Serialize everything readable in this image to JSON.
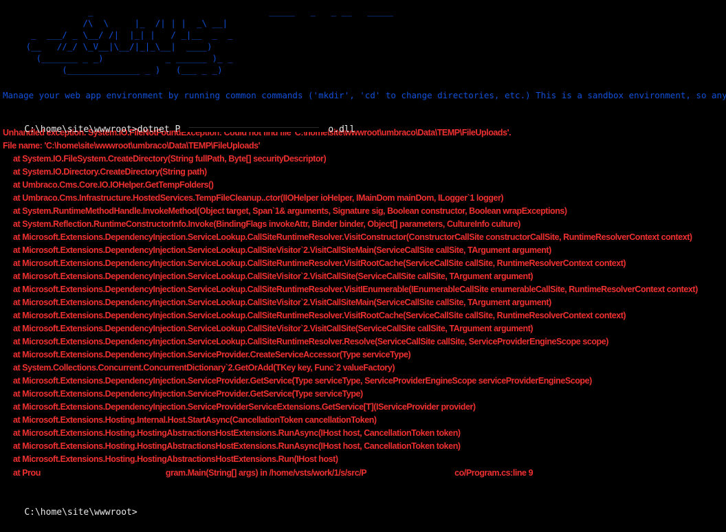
{
  "terminal": {
    "background_color": "#000000",
    "banner_color": "#1050d8",
    "prompt_color": "#e8e8e8",
    "error_color": "#f03030",
    "banner_ascii": "                 _                                  _____   _   _ __   _____\n                /\\  \\     |_  /| | |  _\\ __|\n      _  ___/ _ \\__/ /|  |_| |   / _|__  _  _\n     (__   //_/ \\_V__|\\__/|_|_\\__|  ____)\n       (_______ _ _)            _ ______ )_ _\n            (______________ _ )   (___ _ _)",
    "info_text": "Manage your web app environment by running common commands ('mkdir', 'cd' to change directories, etc.) This is a sandbox environment, so any commands that requ",
    "prompt_path": "C:\\home\\site\\wwwroot>",
    "command_prefix": "dotnet P",
    "command_suffix": "o.dll",
    "final_prompt": "C:\\home\\site\\wwwroot>"
  },
  "error_output": {
    "header_lines": [
      "Unhandled exception. System.IO.FileNotFoundException: Could not find file 'C:\\home\\site\\wwwroot\\umbraco\\Data\\TEMP\\FileUploads'.",
      "File name: 'C:\\home\\site\\wwwroot\\umbraco\\Data\\TEMP\\FileUploads'"
    ],
    "stack_frames": [
      "at System.IO.FileSystem.CreateDirectory(String fullPath, Byte[] securityDescriptor)",
      "at System.IO.Directory.CreateDirectory(String path)",
      "at Umbraco.Cms.Core.IO.IOHelper.GetTempFolders()",
      "at Umbraco.Cms.Infrastructure.HostedServices.TempFileCleanup..ctor(IIOHelper ioHelper, IMainDom mainDom, ILogger`1 logger)",
      "at System.RuntimeMethodHandle.InvokeMethod(Object target, Span`1& arguments, Signature sig, Boolean constructor, Boolean wrapExceptions)",
      "at System.Reflection.RuntimeConstructorInfo.Invoke(BindingFlags invokeAttr, Binder binder, Object[] parameters, CultureInfo culture)",
      "at Microsoft.Extensions.DependencyInjection.ServiceLookup.CallSiteRuntimeResolver.VisitConstructor(ConstructorCallSite constructorCallSite, RuntimeResolverContext context)",
      "at Microsoft.Extensions.DependencyInjection.ServiceLookup.CallSiteVisitor`2.VisitCallSiteMain(ServiceCallSite callSite, TArgument argument)",
      "at Microsoft.Extensions.DependencyInjection.ServiceLookup.CallSiteRuntimeResolver.VisitRootCache(ServiceCallSite callSite, RuntimeResolverContext context)",
      "at Microsoft.Extensions.DependencyInjection.ServiceLookup.CallSiteVisitor`2.VisitCallSite(ServiceCallSite callSite, TArgument argument)",
      "at Microsoft.Extensions.DependencyInjection.ServiceLookup.CallSiteRuntimeResolver.VisitIEnumerable(IEnumerableCallSite enumerableCallSite, RuntimeResolverContext context)",
      "at Microsoft.Extensions.DependencyInjection.ServiceLookup.CallSiteVisitor`2.VisitCallSiteMain(ServiceCallSite callSite, TArgument argument)",
      "at Microsoft.Extensions.DependencyInjection.ServiceLookup.CallSiteRuntimeResolver.VisitRootCache(ServiceCallSite callSite, RuntimeResolverContext context)",
      "at Microsoft.Extensions.DependencyInjection.ServiceLookup.CallSiteVisitor`2.VisitCallSite(ServiceCallSite callSite, TArgument argument)",
      "at Microsoft.Extensions.DependencyInjection.ServiceLookup.CallSiteRuntimeResolver.Resolve(ServiceCallSite callSite, ServiceProviderEngineScope scope)",
      "at Microsoft.Extensions.DependencyInjection.ServiceProvider.CreateServiceAccessor(Type serviceType)",
      "at System.Collections.Concurrent.ConcurrentDictionary`2.GetOrAdd(TKey key, Func`2 valueFactory)",
      "at Microsoft.Extensions.DependencyInjection.ServiceProvider.GetService(Type serviceType, ServiceProviderEngineScope serviceProviderEngineScope)",
      "at Microsoft.Extensions.DependencyInjection.ServiceProvider.GetService(Type serviceType)",
      "at Microsoft.Extensions.DependencyInjection.ServiceProviderServiceExtensions.GetService[T](IServiceProvider provider)",
      "at Microsoft.Extensions.Hosting.Internal.Host.StartAsync(CancellationToken cancellationToken)",
      "at Microsoft.Extensions.Hosting.HostingAbstractionsHostExtensions.RunAsync(IHost host, CancellationToken token)",
      "at Microsoft.Extensions.Hosting.HostingAbstractionsHostExtensions.RunAsync(IHost host, CancellationToken token)",
      "at Microsoft.Extensions.Hosting.HostingAbstractionsHostExtensions.Run(IHost host)"
    ],
    "last_frame": {
      "part1": "at Prou",
      "part2": "gram.Main(String[] args) in /home/vsts/work/1/s/src/P",
      "part3": "co/Program.cs:line 9"
    }
  }
}
